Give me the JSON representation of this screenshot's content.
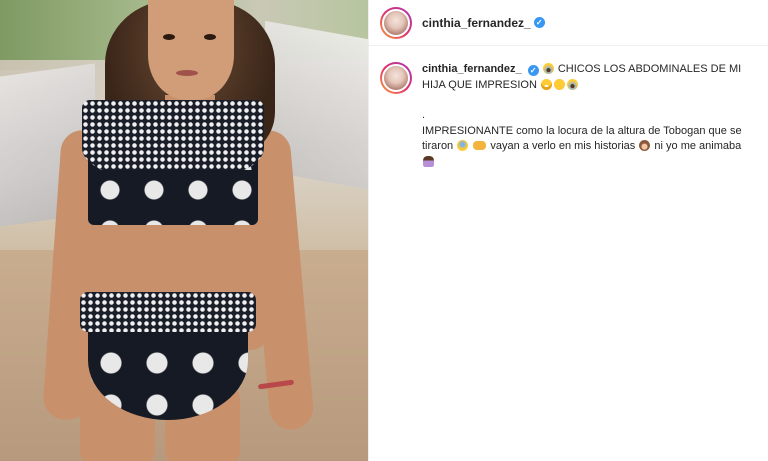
{
  "post": {
    "author": {
      "username": "cinthia_fernandez_",
      "verified": true
    },
    "caption": {
      "username": "cinthia_fernandez_",
      "line1": "CHICOS LOS ABDOMINALES DE MI HIJA QUE IMPRESION",
      "dot": ".",
      "line2a": "IMPRESIONANTE como la locura de la altura de Tobogan que se tiraron",
      "line2b": "vayan a verlo en mis historias",
      "line2c": "ni yo me animaba",
      "emojis": [
        "scream-icon",
        "grin-sweat-icon",
        "blush-icon",
        "scream-icon",
        "cold-sweat-icon",
        "pointing-hand-icon",
        "see-no-evil-monkey-icon",
        "woman-shrugging-icon"
      ]
    }
  },
  "colors": {
    "verified_badge": "#3897f0",
    "text": "#262626",
    "divider": "#efefef"
  }
}
